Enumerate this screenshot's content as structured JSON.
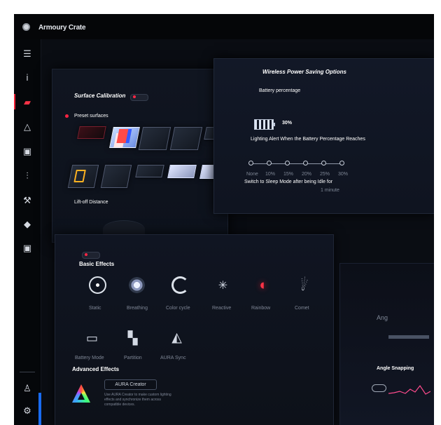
{
  "app": {
    "title": "Armoury Crate"
  },
  "sidebar": {
    "items": [
      {
        "icon": "menu-icon"
      },
      {
        "icon": "info-icon"
      },
      {
        "icon": "device-icon"
      },
      {
        "icon": "triangle-icon"
      },
      {
        "icon": "gamepad-icon"
      },
      {
        "icon": "sliders-icon"
      },
      {
        "icon": "wrench-icon"
      },
      {
        "icon": "tag-icon"
      },
      {
        "icon": "battery-icon"
      },
      {
        "icon": "profile-icon"
      },
      {
        "icon": "settings-icon"
      }
    ]
  },
  "surface_calibration": {
    "title": "Surface Calibration",
    "preset_label": "Preset surfaces",
    "lift_off_label": "Lift-off Distance"
  },
  "wireless_power": {
    "title": "Wireless Power Saving Options",
    "battery_label": "Battery percentage",
    "battery_value": "30%",
    "alert_label": "Lighting Alert When the Battery Percentage Reaches",
    "scale_labels": [
      "None",
      "10%",
      "15%",
      "20%",
      "25%",
      "30%"
    ],
    "sleep_text": "Switch to Sleep Mode after being Idle for",
    "sleep_value": "1 minute"
  },
  "effects": {
    "title": "Basic Effects",
    "row1": [
      {
        "label": "Static",
        "icon": "static-icon"
      },
      {
        "label": "Breathing",
        "icon": "breathing-icon"
      },
      {
        "label": "Color cycle",
        "icon": "color-cycle-icon"
      },
      {
        "label": "Reactive",
        "icon": "reactive-icon"
      },
      {
        "label": "Rainbow",
        "icon": "rainbow-icon"
      },
      {
        "label": "Comet",
        "icon": "comet-icon"
      }
    ],
    "row2": [
      {
        "label": "Battery Mode",
        "icon": "battery-mode-icon"
      },
      {
        "label": "Partition",
        "icon": "partition-icon"
      },
      {
        "label": "AURA Sync",
        "icon": "aura-sync-icon"
      }
    ],
    "advanced_title": "Advanced Effects",
    "creator_button": "AURA Creator",
    "creator_text": "Use AURA Creator to make custom lighting effects and synchronize them across compatible devices."
  },
  "right_lower": {
    "angle_label": "Angle Snapping",
    "small_label": "Ang"
  }
}
